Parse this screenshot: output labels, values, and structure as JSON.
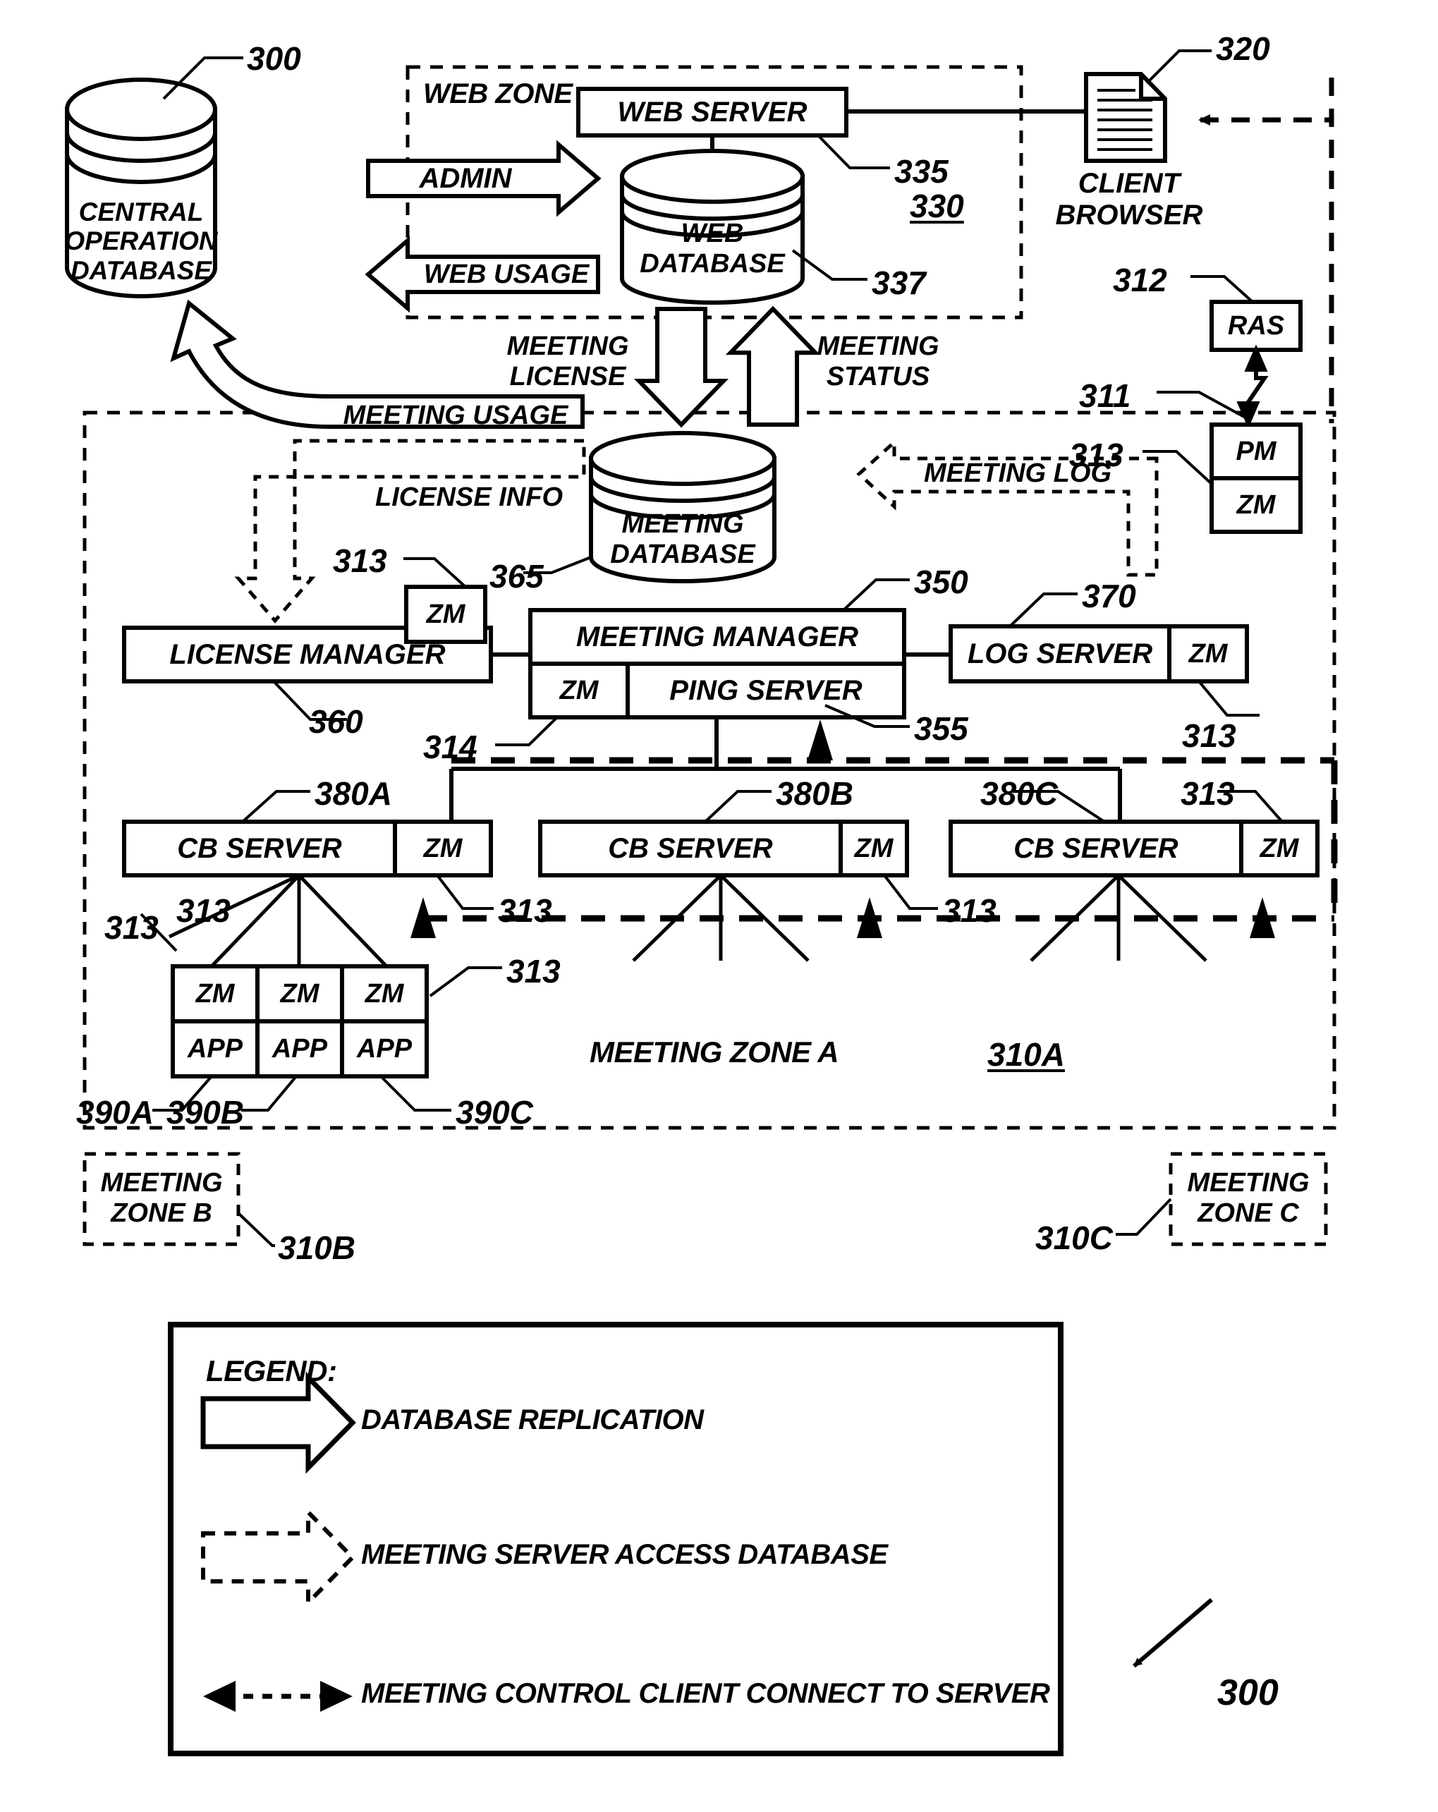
{
  "figure": {
    "ref_main_top": "300",
    "ref_main_bottom": "300"
  },
  "central_db": {
    "line1": "CENTRAL OPERATION",
    "line2": "DATABASE",
    "ref": "300"
  },
  "web_zone": {
    "label": "WEB ZONE",
    "ref": "330",
    "web_server": {
      "label": "WEB SERVER",
      "ref": "335"
    },
    "web_database": {
      "line1": "WEB",
      "line2": "DATABASE",
      "ref": "337"
    }
  },
  "replication_arrows": {
    "admin": "ADMIN",
    "web_usage": "WEB USAGE",
    "meeting_usage": "MEETING USAGE",
    "meeting_license_l1": "MEETING",
    "meeting_license_l2": "LICENSE",
    "meeting_status_l1": "MEETING",
    "meeting_status_l2": "STATUS"
  },
  "dashed_flows": {
    "license_info": "LICENSE INFO",
    "meeting_log": "MEETING LOG"
  },
  "client": {
    "line1": "CLIENT",
    "line2": "BROWSER",
    "ref": "320",
    "icon": "document-icon"
  },
  "access_stack": {
    "ras": {
      "label": "RAS",
      "ref": "312"
    },
    "link_ref": "311",
    "pm": {
      "label": "PM"
    },
    "zm": {
      "label": "ZM",
      "ref": "313"
    }
  },
  "meeting_zone_a": {
    "label": "MEETING ZONE A",
    "ref": "310A",
    "meeting_database": {
      "line1": "MEETING",
      "line2": "DATABASE",
      "ref": "365"
    },
    "license_manager": {
      "label": "LICENSE MANAGER",
      "ref": "360",
      "zm": "ZM",
      "zm_ref": "313"
    },
    "meeting_manager": {
      "label": "MEETING MANAGER",
      "ref": "350",
      "zm": "ZM",
      "zm_ref": "314",
      "ping_server": "PING SERVER",
      "ping_ref": "355"
    },
    "log_server": {
      "label": "LOG SERVER",
      "ref": "370",
      "zm": "ZM",
      "zm_ref": "313"
    },
    "cb_servers": [
      {
        "label": "CB SERVER",
        "ref": "380A",
        "zm": "ZM",
        "zm_ref": "313"
      },
      {
        "label": "CB SERVER",
        "ref": "380B",
        "zm": "ZM",
        "zm_ref": "313"
      },
      {
        "label": "CB SERVER",
        "ref": "380C",
        "zm": "ZM",
        "zm_ref": "313"
      }
    ],
    "clients": [
      {
        "zm": "ZM",
        "app": "APP",
        "ref": "390A"
      },
      {
        "zm": "ZM",
        "app": "APP",
        "ref": "390B"
      },
      {
        "zm": "ZM",
        "app": "APP",
        "ref": "390C"
      }
    ],
    "client_zm_refs": [
      "313",
      "313",
      "313"
    ]
  },
  "meeting_zone_b": {
    "line1": "MEETING",
    "line2": "ZONE B",
    "ref": "310B"
  },
  "meeting_zone_c": {
    "line1": "MEETING",
    "line2": "ZONE C",
    "ref": "310C"
  },
  "legend": {
    "title": "LEGEND:",
    "items": [
      {
        "key": "block-arrow-icon",
        "text": "DATABASE REPLICATION"
      },
      {
        "key": "dashed-block-arrow-icon",
        "text": "MEETING SERVER ACCESS DATABASE"
      },
      {
        "key": "double-dashed-arrow-icon",
        "text": "MEETING CONTROL CLIENT CONNECT TO SERVER"
      }
    ]
  }
}
